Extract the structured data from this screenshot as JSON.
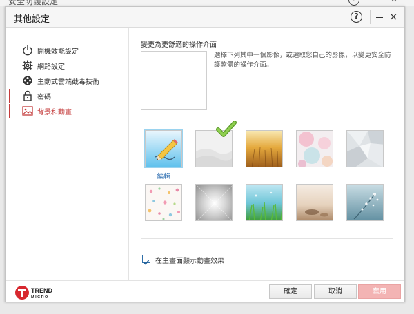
{
  "parent_window": {
    "title": "安全防護設定"
  },
  "dialog": {
    "title": "其他設定",
    "help_label": "?",
    "close_label": "×"
  },
  "sidebar": {
    "items": [
      {
        "label": "開機效能設定",
        "icon": "power-icon"
      },
      {
        "label": "網路設定",
        "icon": "gear-icon"
      },
      {
        "label": "主動式雲端截毒技術",
        "icon": "film-reel-icon"
      },
      {
        "label": "密碼",
        "icon": "lock-icon"
      },
      {
        "label": "背景和動畫",
        "icon": "image-icon"
      }
    ],
    "active_index": 4
  },
  "content": {
    "heading": "變更為更舒適的操作介面",
    "description": "選擇下列其中一個影像，或選取您自己的影像，以變更安全防護軟體的操作介面。",
    "edit_label": "編輯",
    "thumbnails": [
      "edit-custom-image",
      "white-waves-image",
      "golden-wheat-image",
      "pastel-bubbles-image",
      "gray-polygons-image",
      "colorful-dots-image",
      "silver-radial-image",
      "green-grass-image",
      "sandy-beach-image",
      "blue-blossom-image"
    ],
    "selected_index": 1,
    "animation_checkbox": {
      "label": "在主畫面顯示動畫效果",
      "checked": true
    }
  },
  "footer": {
    "logo_text": "TREND",
    "logo_subtext": "MICRO",
    "ok_label": "確定",
    "cancel_label": "取消",
    "apply_label": "套用"
  },
  "colors": {
    "accent": "#c43b3b",
    "apply_disabled": "#f3b4b4",
    "check_green": "#7ac143",
    "link_blue": "#2b6cb0"
  }
}
